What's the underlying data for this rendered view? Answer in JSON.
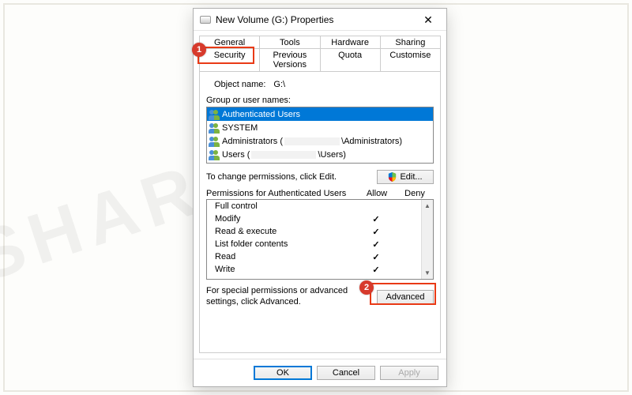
{
  "watermark": "SHAREUS",
  "dialog": {
    "title": "New Volume (G:) Properties",
    "tabs_row1": [
      "General",
      "Tools",
      "Hardware",
      "Sharing"
    ],
    "tabs_row2": [
      "Security",
      "Previous Versions",
      "Quota",
      "Customise"
    ],
    "active_tab": "Security"
  },
  "object": {
    "label": "Object name:",
    "value": "G:\\"
  },
  "group_label": "Group or user names:",
  "users": [
    {
      "name": "Authenticated Users",
      "selected": true
    },
    {
      "name": "SYSTEM",
      "selected": false
    },
    {
      "name": "Administrators (",
      "tail": "\\Administrators)",
      "redact_w": 70,
      "selected": false
    },
    {
      "name": "Users (",
      "tail": "\\Users)",
      "redact_w": 82,
      "selected": false
    }
  ],
  "edit_hint": "To change permissions, click Edit.",
  "edit_button": "Edit...",
  "perm_header": {
    "title": "Permissions for Authenticated Users",
    "allow": "Allow",
    "deny": "Deny"
  },
  "permissions": [
    {
      "name": "Full control",
      "allow": false,
      "deny": false
    },
    {
      "name": "Modify",
      "allow": true,
      "deny": false
    },
    {
      "name": "Read & execute",
      "allow": true,
      "deny": false
    },
    {
      "name": "List folder contents",
      "allow": true,
      "deny": false
    },
    {
      "name": "Read",
      "allow": true,
      "deny": false
    },
    {
      "name": "Write",
      "allow": true,
      "deny": false
    }
  ],
  "adv_hint": "For special permissions or advanced settings, click Advanced.",
  "adv_button": "Advanced",
  "buttons": {
    "ok": "OK",
    "cancel": "Cancel",
    "apply": "Apply"
  },
  "markers": {
    "one": "1",
    "two": "2"
  }
}
